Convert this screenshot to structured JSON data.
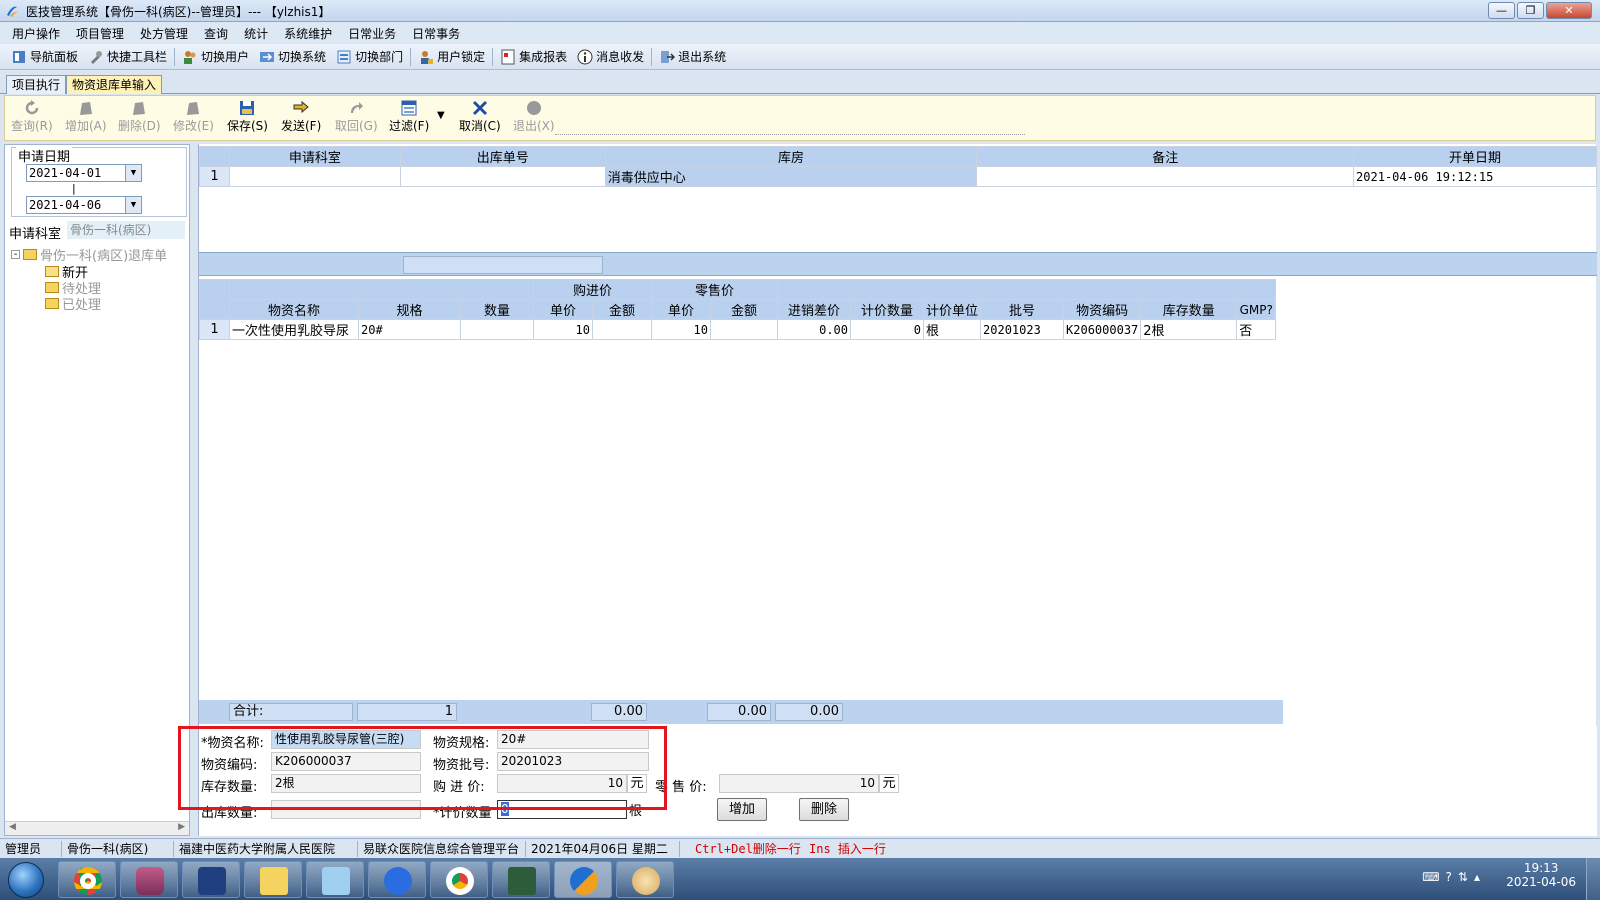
{
  "window": {
    "title": "医技管理系统【骨伤一科(病区)--管理员】--- 【ylzhis1】",
    "controls": [
      "—",
      "❐",
      "✕"
    ]
  },
  "menubar": [
    "用户操作",
    "项目管理",
    "处方管理",
    "查询",
    "统计",
    "系统维护",
    "日常业务",
    "日常事务"
  ],
  "toolbar": [
    "导航面板",
    "快捷工具栏",
    "切换用户",
    "切换系统",
    "切换部门",
    "用户锁定",
    "集成报表",
    "消息收发",
    "退出系统"
  ],
  "tabs": [
    "项目执行",
    "物资退库单输入"
  ],
  "actions": [
    {
      "label": "查询(R)",
      "enabled": false
    },
    {
      "label": "增加(A)",
      "enabled": false
    },
    {
      "label": "删除(D)",
      "enabled": false
    },
    {
      "label": "修改(E)",
      "enabled": false
    },
    {
      "label": "保存(S)",
      "enabled": true
    },
    {
      "label": "发送(F)",
      "enabled": true
    },
    {
      "label": "取回(G)",
      "enabled": false
    },
    {
      "label": "过滤(F)",
      "enabled": true
    },
    {
      "label": "取消(C)",
      "enabled": true
    },
    {
      "label": "退出(X)",
      "enabled": false
    }
  ],
  "left_panel": {
    "date_legend": "申请日期",
    "date_from": "2021-04-01",
    "date_sep": "|",
    "date_to": "2021-04-06",
    "dept_label": "申请科室",
    "dept_value": "骨伤一科(病区)",
    "tree": {
      "root": "骨伤一科(病区)退库单",
      "children": [
        "新开",
        "待处理",
        "已处理"
      ]
    }
  },
  "header_grid": {
    "columns": [
      "申请科室",
      "出库单号",
      "库房",
      "备注",
      "开单日期"
    ],
    "rows": [
      {
        "num": "1",
        "dept": "",
        "out_no": "",
        "store": "消毒供应中心",
        "note": "",
        "date": "2021-04-06 19:12:15"
      }
    ]
  },
  "detail_grid": {
    "group_headers": {
      "purchase": "购进价",
      "retail": "零售价"
    },
    "columns": [
      "物资名称",
      "规格",
      "数量",
      "单价",
      "金额",
      "单价",
      "金额",
      "进销差价",
      "计价数量",
      "计价单位",
      "批号",
      "物资编码",
      "库存数量",
      "GMP?"
    ],
    "rows": [
      {
        "num": "1",
        "name": "一次性使用乳胶导尿",
        "spec": "20#",
        "qty": "",
        "p_price": "10",
        "p_amount": "",
        "r_price": "10",
        "r_amount": "",
        "diff": "0.00",
        "calc_qty": "0",
        "calc_unit": "根",
        "batch": "20201023",
        "code": "K206000037",
        "stock": "2根",
        "gmp": "否"
      }
    ],
    "totals": {
      "label": "合计:",
      "qty": "1",
      "p_amount": "0.00",
      "r_amount": "0.00",
      "diff": "0.00"
    }
  },
  "form": {
    "name_label": "*物资名称:",
    "name_value": "性使用乳胶导尿管(三腔)",
    "spec_label": "物资规格:",
    "spec_value": "20#",
    "code_label": "物资编码:",
    "code_value": "K206000037",
    "batch_label": "物资批号:",
    "batch_value": "20201023",
    "stock_label": "库存数量:",
    "stock_value": "2根",
    "purchase_label": "购 进 价:",
    "purchase_value": "10",
    "retail_label": "零 售 价:",
    "retail_value": "10",
    "unit_yuan": "元",
    "out_qty_label": "出库数量:",
    "out_qty_value": "",
    "calc_qty_label": "*计价数量",
    "calc_qty_value": "0",
    "calc_unit": "根",
    "add_button": "增加",
    "delete_button": "删除"
  },
  "statusbar": [
    "管理员",
    "骨伤一科(病区)",
    "福建中医药大学附属人民医院",
    "易联众医院信息综合管理平台",
    "2021年04月06日 星期二",
    "Ctrl+Del删除一行",
    "Ins 插入一行"
  ],
  "taskbar": {
    "time": "19:13",
    "date": "2021-04-06"
  }
}
